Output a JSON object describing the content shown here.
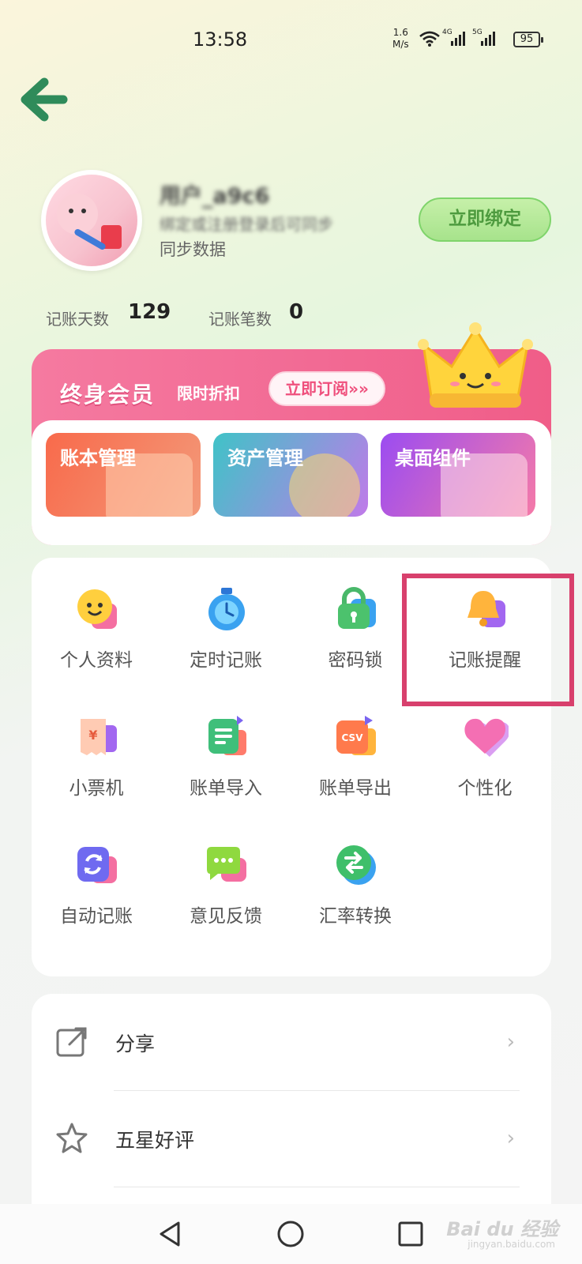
{
  "status_bar": {
    "time": "13:58",
    "net_speed_value": "1.6",
    "net_speed_unit": "M/s",
    "signal1": "4G",
    "signal2": "5G",
    "battery": "95"
  },
  "profile": {
    "username": "用户_a9c6",
    "bind_hint": "绑定或注册登录后可同步",
    "sync_text": "同步数据",
    "bind_button": "立即绑定"
  },
  "stats": [
    {
      "label": "记账天数",
      "value": "129"
    },
    {
      "label": "记账笔数",
      "value": "0"
    }
  ],
  "vip": {
    "title": "终身会员",
    "subtitle": "限时折扣",
    "subscribe_button": "立即订阅»»",
    "features": [
      {
        "label": "账本管理",
        "color_from": "#f86a4b",
        "color_to": "#f39a7a"
      },
      {
        "label": "资产管理",
        "color_from": "#3fc3c7",
        "color_to": "#c07ae9"
      },
      {
        "label": "桌面组件",
        "color_from": "#9b4cf1",
        "color_to": "#f57aa8"
      }
    ]
  },
  "grid_items": [
    {
      "label": "个人资料",
      "icon": "smiley-face-icon"
    },
    {
      "label": "定时记账",
      "icon": "stopwatch-icon"
    },
    {
      "label": "密码锁",
      "icon": "padlock-icon"
    },
    {
      "label": "记账提醒",
      "icon": "bell-icon"
    },
    {
      "label": "小票机",
      "icon": "receipt-icon"
    },
    {
      "label": "账单导入",
      "icon": "document-import-icon"
    },
    {
      "label": "账单导出",
      "icon": "csv-export-icon"
    },
    {
      "label": "个性化",
      "icon": "heart-icon"
    },
    {
      "label": "自动记账",
      "icon": "refresh-icon"
    },
    {
      "label": "意见反馈",
      "icon": "chat-bubble-icon"
    },
    {
      "label": "汇率转换",
      "icon": "exchange-icon"
    }
  ],
  "list_items": [
    {
      "label": "分享",
      "icon": "share-icon"
    },
    {
      "label": "五星好评",
      "icon": "star-icon"
    }
  ],
  "watermark": {
    "brand": "Bai du 经验",
    "url": "jingyan.baidu.com"
  },
  "colors": {
    "accent_green": "#4e9b3f",
    "vip_pink": "#f26a94",
    "highlight": "#d8406d"
  }
}
